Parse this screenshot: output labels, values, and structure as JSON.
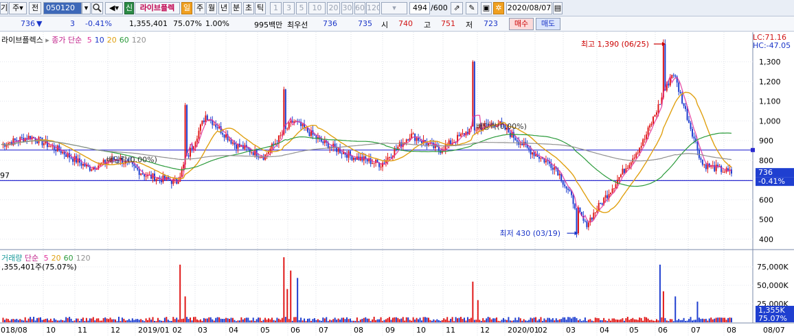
{
  "toolbar": {
    "left_fragment": "기",
    "type_select": "주",
    "whole_label": "전",
    "code": "050120",
    "stock_name": "라이브플렉",
    "period_buttons": [
      "일",
      "주",
      "월",
      "년",
      "분",
      "초",
      "틱"
    ],
    "interval_buttons": [
      "1",
      "3",
      "5",
      "10",
      "20",
      "30",
      "60",
      "120"
    ],
    "count_value": "494",
    "count_max": "/600",
    "date": "2020/08/07"
  },
  "quote": {
    "price": "736",
    "change_arrow": "▼",
    "change": "3",
    "change_rate": "-0.41%",
    "volume": "1,355,401",
    "volume_ratio": "75.07%",
    "turnover": "1.00%",
    "amount": "995백만",
    "best_label": "최우선",
    "best_ask": "736",
    "best_bid": "735",
    "open_label": "시",
    "open": "740",
    "high_label": "고",
    "high": "751",
    "low_label": "저",
    "low": "723",
    "buy_button": "매수",
    "sell_button": "매도"
  },
  "price_panel": {
    "legend_name": "라이브플렉스",
    "legend_ma": "종가 단순",
    "ma_periods": [
      "5",
      "10",
      "20",
      "60",
      "120"
    ],
    "ma_colors": [
      "#e0309a",
      "#1a35c8",
      "#e0a010",
      "#2a9a3a",
      "#909090"
    ],
    "lc_label": "LC:71.16",
    "hc_label": "HC:-47.05",
    "y_ticks": [
      "1,300",
      "1,200",
      "1,100",
      "1,000",
      "900",
      "800",
      "700",
      "600",
      "500",
      "400"
    ],
    "current_price_tag": "736",
    "current_rate_tag": "-0.41%",
    "left_cut_value": "97",
    "high_annotation": "최고 1,390 (06/25)",
    "low_annotation": "최저 430 (03/19)",
    "ex_dividend_1": "배당락(0.00%)",
    "ex_dividend_2": "배당락(0.00%)"
  },
  "volume_panel": {
    "legend_name": "거래량",
    "legend_ma": "단순",
    "ma_periods": [
      "5",
      "20",
      "60",
      "120"
    ],
    "ma_colors": [
      "#e0309a",
      "#e0a010",
      "#2a9a3a",
      "#909090"
    ],
    "volume_text": ",355,401주(75.07%)",
    "y_ticks": [
      "75,000K",
      "50,000K",
      "25,000K"
    ],
    "current_volume_tag": "1,355K",
    "current_ratio_tag": "75.07%"
  },
  "x_axis": {
    "labels": [
      "018/08",
      "10",
      "11",
      "12",
      "2019/01",
      "02",
      "03",
      "04",
      "05",
      "06",
      "07",
      "08",
      "09",
      "10",
      "11",
      "12",
      "2020/01",
      "02",
      "03",
      "04",
      "05",
      "06",
      "07",
      "08",
      "08/07"
    ]
  },
  "chart_data": {
    "type": "candlestick",
    "title": "라이브플렉스",
    "y_ticks": [
      1300,
      1200,
      1100,
      1000,
      900,
      800,
      700,
      600,
      500,
      400
    ],
    "ylim": [
      350,
      1420
    ],
    "x_range": [
      "2018/08",
      "2020/08/07"
    ],
    "highest": {
      "value": 1390,
      "date": "06/25"
    },
    "lowest": {
      "value": 430,
      "date": "03/19"
    },
    "current_price": 736,
    "support_line": 697,
    "resistance_line": 852,
    "close_series": [
      {
        "date": "2018/08",
        "close": 880
      },
      {
        "date": "2018/09",
        "close": 920
      },
      {
        "date": "2018/10",
        "close": 850
      },
      {
        "date": "2018/10b",
        "close": 760
      },
      {
        "date": "2018/11",
        "close": 810
      },
      {
        "date": "2018/12",
        "close": 720
      },
      {
        "date": "2019/01",
        "close": 690
      },
      {
        "date": "2019/02",
        "close": 1030
      },
      {
        "date": "2019/03",
        "close": 880
      },
      {
        "date": "2019/04",
        "close": 820
      },
      {
        "date": "2019/05",
        "close": 1000
      },
      {
        "date": "2019/06",
        "close": 890
      },
      {
        "date": "2019/07",
        "close": 820
      },
      {
        "date": "2019/08",
        "close": 780
      },
      {
        "date": "2019/09",
        "close": 930
      },
      {
        "date": "2019/10",
        "close": 850
      },
      {
        "date": "2019/11",
        "close": 950
      },
      {
        "date": "2019/12",
        "close": 990
      },
      {
        "date": "2020/01",
        "close": 860
      },
      {
        "date": "2020/02",
        "close": 760
      },
      {
        "date": "2020/03",
        "close": 470
      },
      {
        "date": "2020/04",
        "close": 680
      },
      {
        "date": "2020/05",
        "close": 900
      },
      {
        "date": "2020/06",
        "close": 1250
      },
      {
        "date": "2020/07",
        "close": 780
      },
      {
        "date": "2020/08",
        "close": 736
      }
    ],
    "volume_ticks": [
      75000,
      50000,
      25000
    ],
    "volume_unit": "K",
    "current_volume": "1,355K"
  }
}
